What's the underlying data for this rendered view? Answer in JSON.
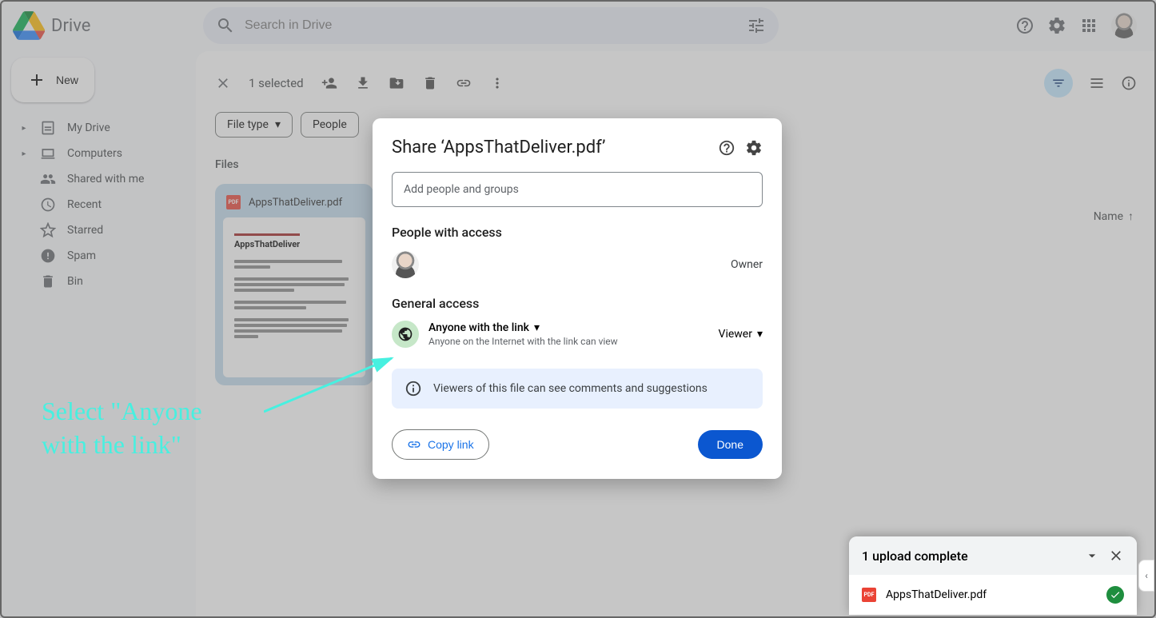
{
  "app_name": "Drive",
  "search_placeholder": "Search in Drive",
  "new_button": "New",
  "sidebar": {
    "items": [
      {
        "label": "My Drive",
        "caret": true
      },
      {
        "label": "Computers",
        "caret": true
      },
      {
        "label": "Shared with me",
        "caret": false
      },
      {
        "label": "Recent",
        "caret": false
      },
      {
        "label": "Starred",
        "caret": false
      },
      {
        "label": "Spam",
        "caret": false
      },
      {
        "label": "Bin",
        "caret": false
      }
    ]
  },
  "toolbar": {
    "selected_label": "1 selected"
  },
  "chips": {
    "file_type": "File type",
    "people": "People"
  },
  "files_section_label": "Files",
  "sort_label": "Name",
  "file_card": {
    "title": "AppsThatDeliver.pdf",
    "doc_title": "AppsThatDeliver"
  },
  "dialog": {
    "title": "Share ‘AppsThatDeliver.pdf’",
    "add_placeholder": "Add people and groups",
    "people_heading": "People with access",
    "owner_label": "Owner",
    "general_heading": "General access",
    "ga_option": "Anyone with the link",
    "ga_desc": "Anyone on the Internet with the link can view",
    "role": "Viewer",
    "info_text": "Viewers of this file can see comments and suggestions",
    "copy_link": "Copy link",
    "done": "Done"
  },
  "annotation": {
    "line1": "Select \"Anyone",
    "line2": "with the link\""
  },
  "toast": {
    "title": "1 upload complete",
    "file": "AppsThatDeliver.pdf"
  }
}
